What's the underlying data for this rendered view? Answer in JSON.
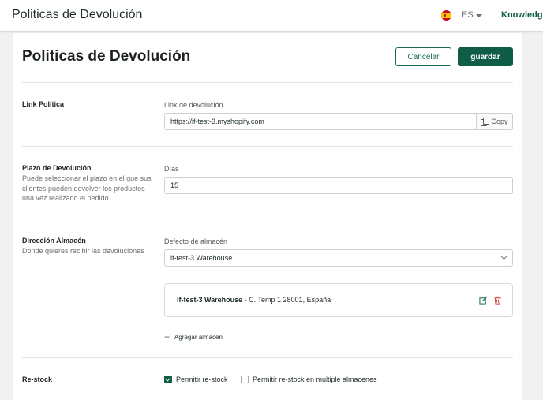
{
  "header": {
    "app_title": "Politicas de Devolución",
    "language": "ES",
    "knowledge_link": "Knowledge"
  },
  "page": {
    "title": "Politicas de Devolución",
    "cancel_label": "Cancelar",
    "save_label": "guardar"
  },
  "link_policy": {
    "title": "Link Política",
    "field_label": "Link de devolución",
    "value": "https://if-test-3.myshopify.com",
    "copy_label": "Copy"
  },
  "return_period": {
    "title": "Plazo de Devolución",
    "description": "Puede seleccionar el plazo en el que sus clientes pueden devolver los productos una vez realizado el pedido.",
    "field_label": "Días",
    "value": "15"
  },
  "warehouse_address": {
    "title": "Dirección Almacén",
    "description": "Donde quieres recibir las devoluciones",
    "field_label": "Defecto de almacén",
    "selected": "if-test-3 Warehouse",
    "warehouse_name": "if-test-3 Warehouse",
    "warehouse_address": " - C. Temp 1 28001, España",
    "add_label": "Agregar almacén"
  },
  "restock": {
    "title": "Re-stock",
    "option1_label": "Permitir re-stock",
    "option1_checked": true,
    "option2_label": "Permitir re-stock en multiple almacenes",
    "option2_checked": false
  },
  "colors": {
    "brand": "#0f5c47",
    "delete": "#d33b3b"
  }
}
